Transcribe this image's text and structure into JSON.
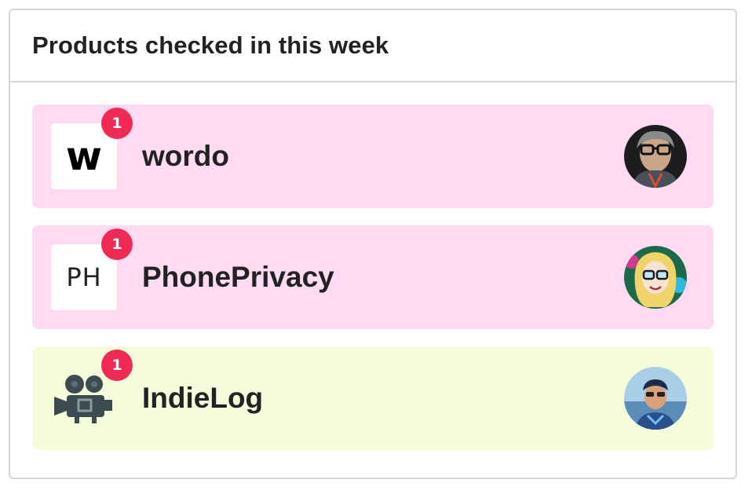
{
  "card": {
    "title": "Products checked in this week"
  },
  "products": [
    {
      "name": "wordo",
      "logo_text": "w",
      "badge": "1",
      "bg": "#fedaf3",
      "logo_icon": "wordo-logo-icon",
      "avatar_icon": "user-avatar-icon"
    },
    {
      "name": "PhonePrivacy",
      "logo_text": "PH",
      "badge": "1",
      "bg": "#fedaf3",
      "logo_icon": "phoneprivacy-logo-icon",
      "avatar_icon": "user-avatar-icon"
    },
    {
      "name": "IndieLog",
      "logo_text": "",
      "badge": "1",
      "bg": "#f5fcdc",
      "logo_icon": "movie-camera-icon",
      "avatar_icon": "user-avatar-icon"
    }
  ],
  "colors": {
    "badge": "#ee2a55",
    "pink_row": "#fedaf3",
    "green_row": "#f5fcdc",
    "border": "#d6d6d6"
  }
}
